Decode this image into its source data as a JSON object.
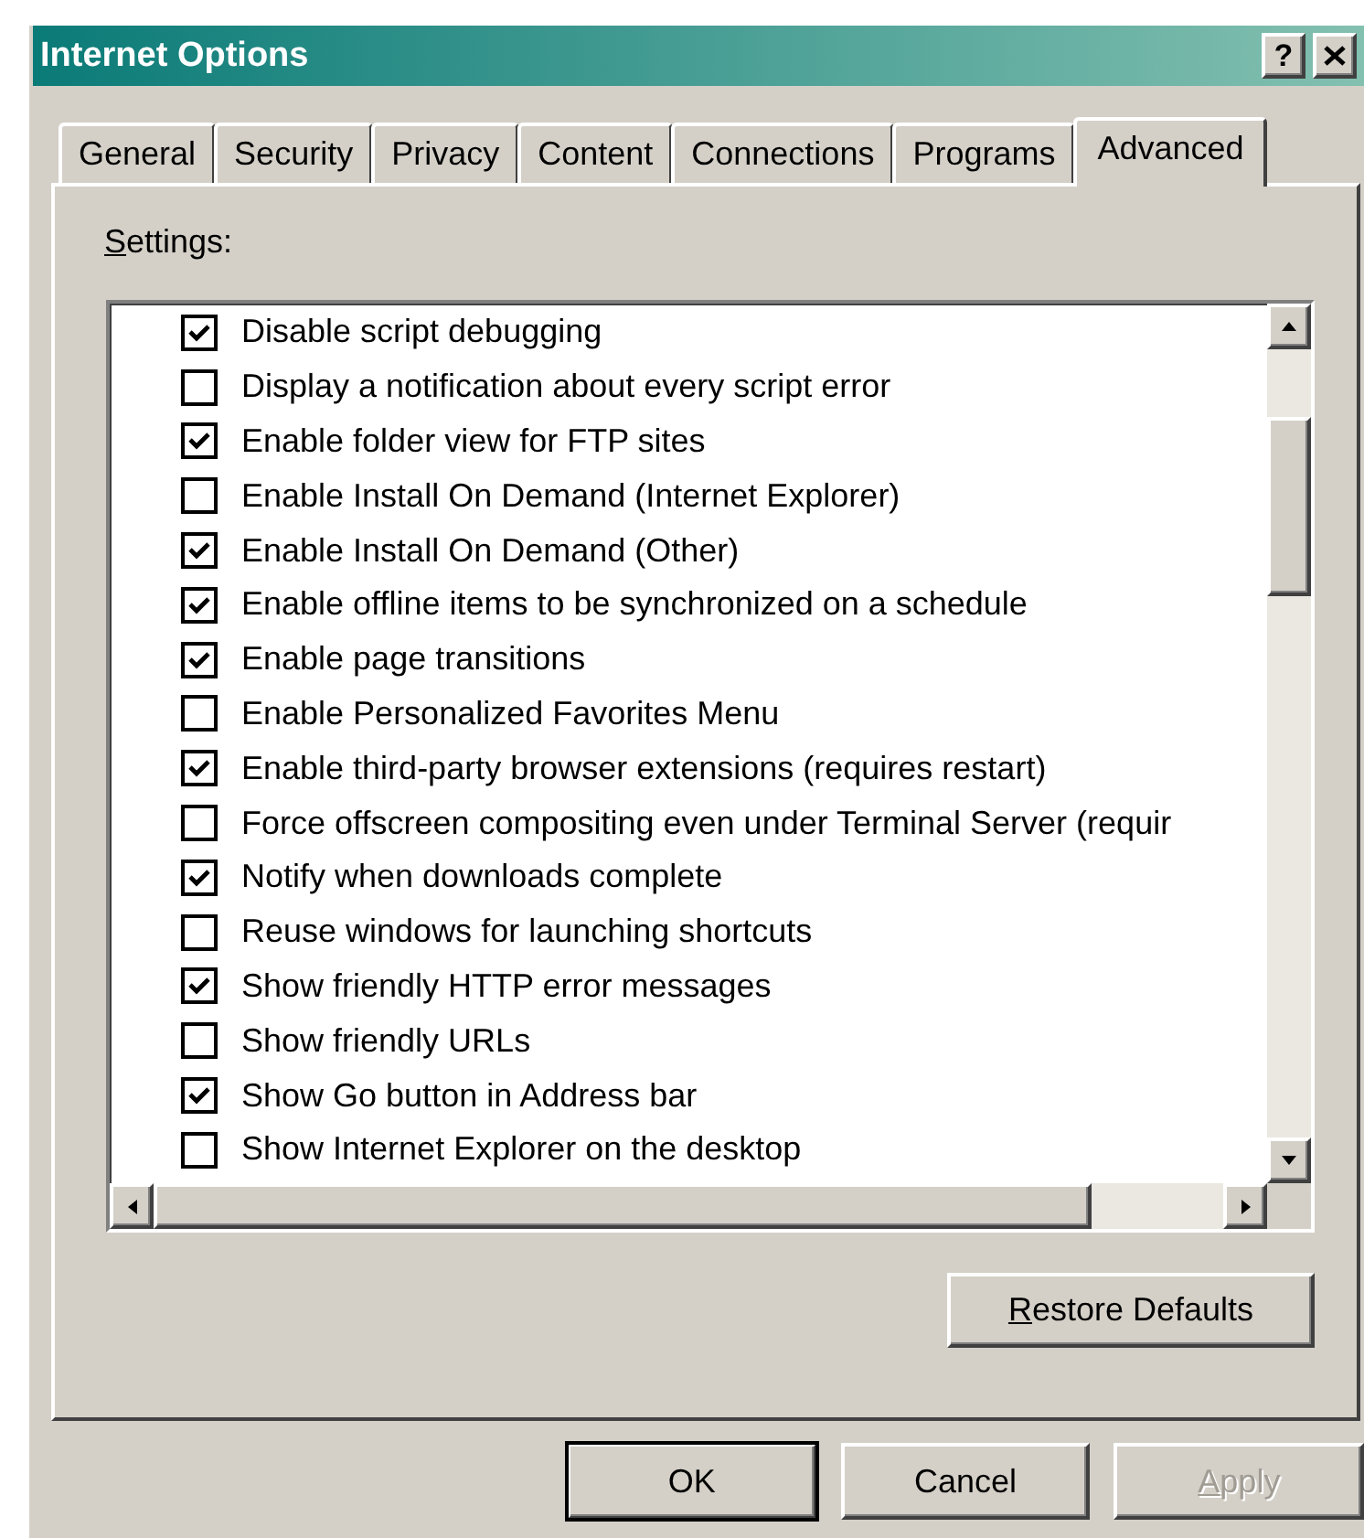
{
  "window": {
    "title": "Internet Options",
    "help_button": "?"
  },
  "tabs": [
    {
      "label": "General",
      "selected": false
    },
    {
      "label": "Security",
      "selected": false
    },
    {
      "label": "Privacy",
      "selected": false
    },
    {
      "label": "Content",
      "selected": false
    },
    {
      "label": "Connections",
      "selected": false
    },
    {
      "label": "Programs",
      "selected": false
    },
    {
      "label": "Advanced",
      "selected": true
    }
  ],
  "settings_label": {
    "text": "Settings:",
    "underline_first": true
  },
  "settings": [
    {
      "label": "Disable script debugging",
      "checked": true
    },
    {
      "label": "Display a notification about every script error",
      "checked": false
    },
    {
      "label": "Enable folder view for FTP sites",
      "checked": true
    },
    {
      "label": "Enable Install On Demand (Internet Explorer)",
      "checked": false
    },
    {
      "label": "Enable Install On Demand (Other)",
      "checked": true
    },
    {
      "label": "Enable offline items to be synchronized on a schedule",
      "checked": true
    },
    {
      "label": "Enable page transitions",
      "checked": true
    },
    {
      "label": "Enable Personalized Favorites Menu",
      "checked": false
    },
    {
      "label": "Enable third-party browser extensions (requires restart)",
      "checked": true
    },
    {
      "label": "Force offscreen compositing even under Terminal Server (requir",
      "checked": false
    },
    {
      "label": "Notify when downloads complete",
      "checked": true
    },
    {
      "label": "Reuse windows for launching shortcuts",
      "checked": false
    },
    {
      "label": "Show friendly HTTP error messages",
      "checked": true
    },
    {
      "label": "Show friendly URLs",
      "checked": false
    },
    {
      "label": "Show Go button in Address bar",
      "checked": true
    },
    {
      "label": "Show Internet Explorer on the desktop",
      "checked": false
    }
  ],
  "restore_button": {
    "label": "Restore Defaults",
    "underline_first": true
  },
  "buttons": [
    {
      "label": "OK",
      "default": true,
      "disabled": false,
      "underline_first": false
    },
    {
      "label": "Cancel",
      "default": false,
      "disabled": false,
      "underline_first": false
    },
    {
      "label": "Apply",
      "default": false,
      "disabled": true,
      "underline_first": true
    }
  ]
}
